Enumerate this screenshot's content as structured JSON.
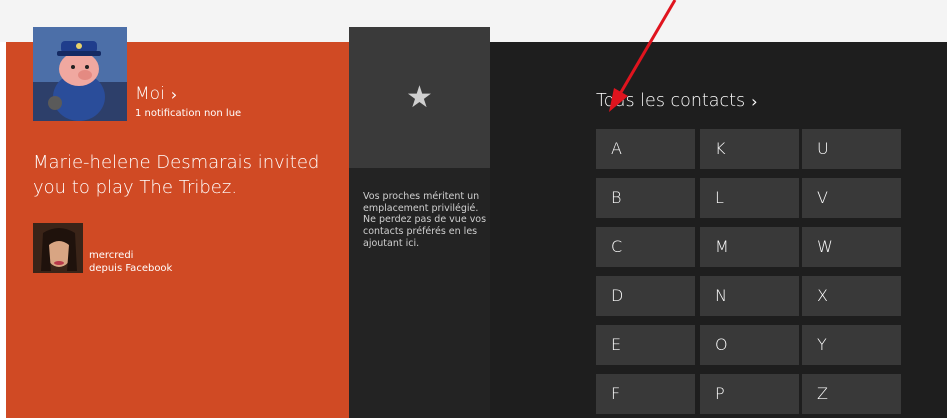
{
  "me": {
    "name": "Moi",
    "chevron": "›",
    "notification_count": "1 notification non lue"
  },
  "notification": {
    "text": "Marie-helene Desmarais invited you to play The Tribez.",
    "day": "mercredi",
    "source": "depuis Facebook"
  },
  "favorites": {
    "icon": "star-icon",
    "star_glyph": "★",
    "description": "Vos proches méritent un emplacement privilégié. Ne perdez pas de vue vos contacts préférés en les ajoutant ici."
  },
  "contacts": {
    "title": "Tous les contacts",
    "chevron": "›",
    "letters": [
      "A",
      "B",
      "C",
      "D",
      "E",
      "F",
      "K",
      "L",
      "M",
      "N",
      "O",
      "P",
      "U",
      "V",
      "W",
      "X",
      "Y",
      "Z"
    ]
  },
  "colors": {
    "me_panel": "#d04a24",
    "background": "#1e1e1e",
    "tile": "#393939",
    "arrow": "#e0141e"
  }
}
